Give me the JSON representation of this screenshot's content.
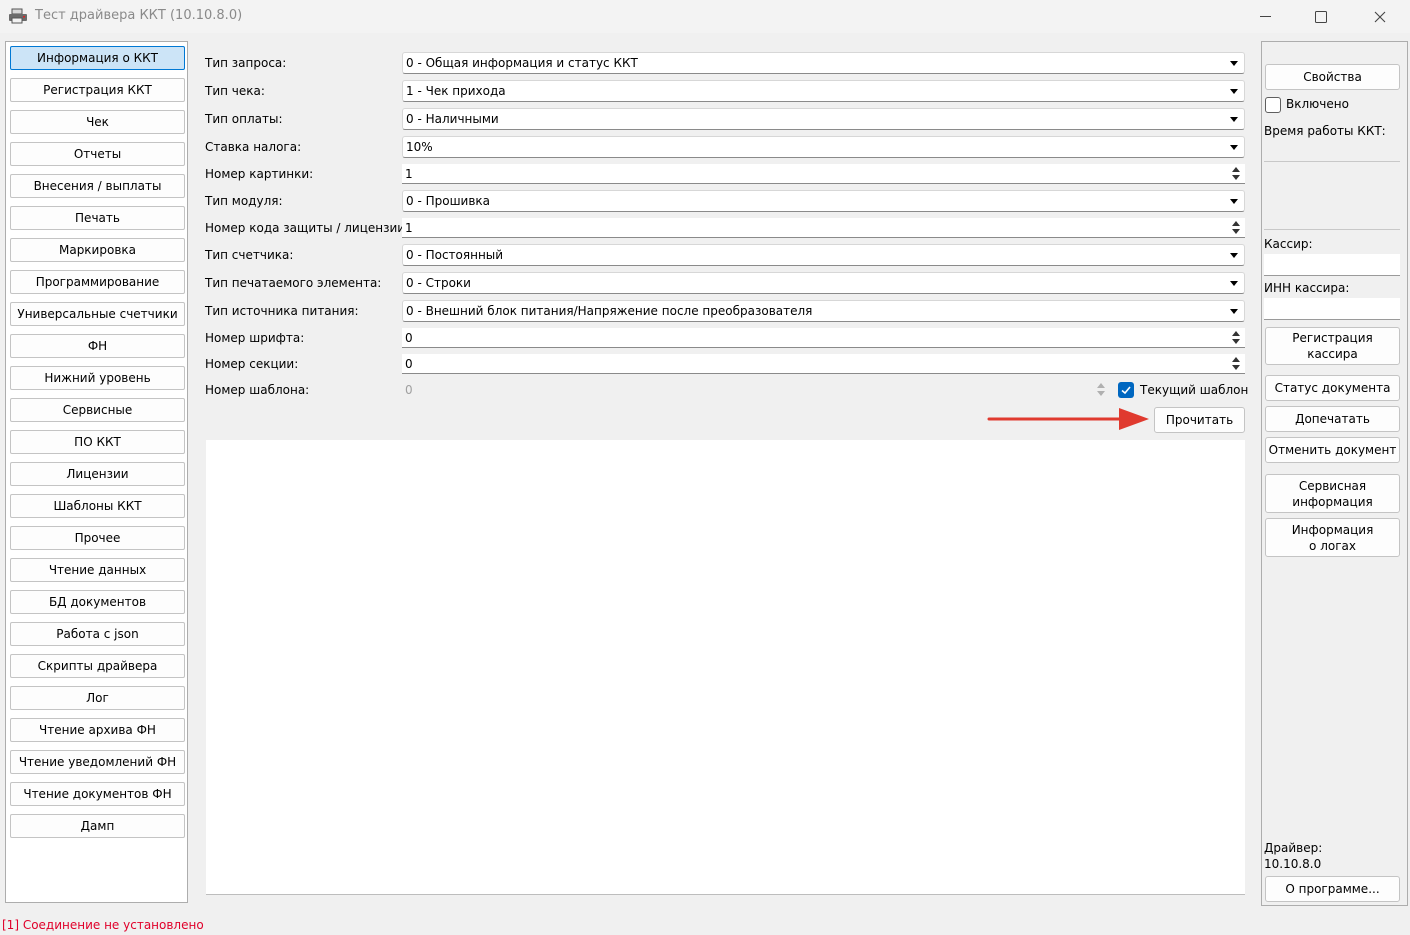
{
  "window": {
    "title": "Тест драйвера ККТ (10.10.8.0)",
    "controls": [
      "minimize-icon",
      "maximize-icon",
      "close-icon"
    ]
  },
  "nav": {
    "items": [
      {
        "label": "Информация о ККТ",
        "active": true
      },
      {
        "label": "Регистрация ККТ"
      },
      {
        "label": "Чек"
      },
      {
        "label": "Отчеты"
      },
      {
        "label": "Внесения / выплаты"
      },
      {
        "label": "Печать"
      },
      {
        "label": "Маркировка"
      },
      {
        "label": "Программирование"
      },
      {
        "label": "Универсальные счетчики"
      },
      {
        "label": "ФН"
      },
      {
        "label": "Нижний уровень"
      },
      {
        "label": "Сервисные"
      },
      {
        "label": "ПО ККТ"
      },
      {
        "label": "Лицензии"
      },
      {
        "label": "Шаблоны ККТ"
      },
      {
        "label": "Прочее"
      },
      {
        "label": "Чтение данных"
      },
      {
        "label": "БД документов"
      },
      {
        "label": "Работа с json"
      },
      {
        "label": "Скрипты драйвера"
      },
      {
        "label": "Лог"
      },
      {
        "label": "Чтение архива ФН"
      },
      {
        "label": "Чтение уведомлений ФН"
      },
      {
        "label": "Чтение документов ФН"
      },
      {
        "label": "Дамп"
      }
    ]
  },
  "form": {
    "fields": [
      {
        "label": "Тип запроса:",
        "type": "combo",
        "value": "0 - Общая информация и статус ККТ"
      },
      {
        "label": "Тип чека:",
        "type": "combo",
        "value": "1 - Чек прихода"
      },
      {
        "label": "Тип оплаты:",
        "type": "combo",
        "value": "0 - Наличными"
      },
      {
        "label": "Ставка налога:",
        "type": "combo",
        "value": "10%"
      },
      {
        "label": "Номер картинки:",
        "type": "spin",
        "value": "1"
      },
      {
        "label": "Тип модуля:",
        "type": "combo",
        "value": "0 - Прошивка"
      },
      {
        "label": "Номер кода защиты / лицензии:",
        "type": "spin",
        "value": "1"
      },
      {
        "label": "Тип счетчика:",
        "type": "combo",
        "value": "0 - Постоянный"
      },
      {
        "label": "Тип печатаемого элемента:",
        "type": "combo",
        "value": "0 - Строки"
      },
      {
        "label": "Тип источника питания:",
        "type": "combo",
        "value": "0 - Внешний блок питания/Напряжение после преобразователя"
      },
      {
        "label": "Номер шрифта:",
        "type": "spin",
        "value": "0"
      },
      {
        "label": "Номер секции:",
        "type": "spin",
        "value": "0"
      },
      {
        "label": "Номер шаблона:",
        "type": "spin-disabled",
        "value": "0"
      }
    ],
    "current_template_label": "Текущий шаблон",
    "current_template_checked": true,
    "read_button": "Прочитать",
    "output_text": ""
  },
  "right": {
    "properties_button": "Свойства",
    "enabled_label": "Включено",
    "enabled_checked": false,
    "uptime_label": "Время работы ККТ:",
    "cashier_label": "Кассир:",
    "cashier_value": "",
    "cashier_inn_label": "ИНН кассира:",
    "cashier_inn_value": "",
    "register_cashier_button": "Регистрация кассира",
    "doc_status_button": "Статус документа",
    "reprint_button": "Допечатать",
    "cancel_doc_button": "Отменить документ",
    "service_info_button": "Сервисная информация",
    "logs_info_button": "Информация о логах",
    "driver_label": "Драйвер:",
    "driver_version": "10.10.8.0",
    "about_button": "О программе..."
  },
  "status_bar": {
    "text": "[1] Соединение не установлено",
    "color": "#e0002a"
  },
  "colors": {
    "accent": "#0067c0",
    "active_nav_bg": "#cce4f7",
    "annotation_arrow": "#e03a2f"
  }
}
